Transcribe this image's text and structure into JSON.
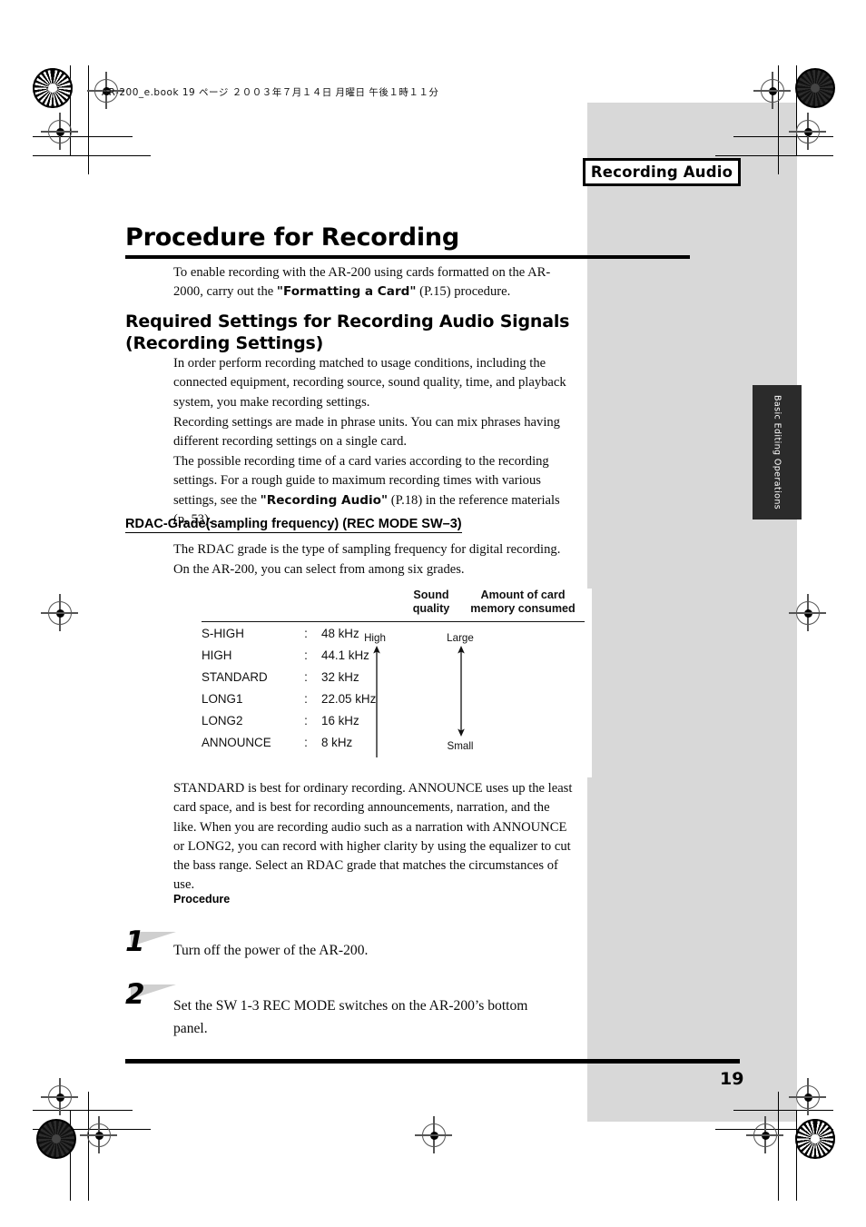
{
  "document": {
    "filestamp": "AR-200_e.book  19 ページ  ２００３年７月１４日   月曜日   午後１時１１分",
    "chapter_tab": "Recording Audio",
    "side_tab": "Basic Editing Operations",
    "page_number": "19"
  },
  "headings": {
    "h1": "Procedure for Recording",
    "h2_line1": "Required Settings for Recording Audio Signals",
    "h2_line2": "(Recording Settings)",
    "h3": "RDAC-Grade(sampling frequency) (REC MODE SW–3)"
  },
  "paragraphs": {
    "intro_a": "To enable recording with the AR-200 using cards formatted on the AR-2000,",
    "intro_b_pre": "carry out the ",
    "intro_b_bold": "\"Formatting a Card\"",
    "intro_b_post": " (P.15) procedure.",
    "p1": "In order perform recording matched to usage conditions, including the connected equipment, recording source, sound quality, time, and playback system, you make recording settings.",
    "p2": "Recording settings are made in phrase units. You can mix phrases having different recording settings on a single card.",
    "p3_pre": "The possible recording time of a card varies according to the recording settings. For a rough guide to maximum recording times with various settings, see the ",
    "p3_bold": "\"Recording Audio\"",
    "p3_post": " (P.18) in the reference materials (p. 53).",
    "p4": "The RDAC grade is the type of sampling frequency for digital recording.",
    "p5": "On the AR-200, you can select from among six grades.",
    "p6": "STANDARD is best for ordinary recording. ANNOUNCE uses up the least card space, and is best for recording announcements, narration, and the like. When you are recording audio such as a narration with ANNOUNCE or LONG2, you can record with higher clarity by using the equalizer to cut the bass range. Select an RDAC grade that matches the circumstances of use."
  },
  "table": {
    "headers": {
      "grade": "",
      "colon": "",
      "frequency": "",
      "sound_quality": "Sound\nquality",
      "sound_quality_l1": "Sound",
      "sound_quality_l2": "quality",
      "memory_l1": "Amount of card",
      "memory_l2": "memory consumed"
    },
    "rows": [
      {
        "grade": "S-HIGH",
        "colon": ":",
        "frequency": "48 kHz"
      },
      {
        "grade": "HIGH",
        "colon": ":",
        "frequency": "44.1 kHz"
      },
      {
        "grade": "STANDARD",
        "colon": ":",
        "frequency": "32 kHz"
      },
      {
        "grade": "LONG1",
        "colon": ":",
        "frequency": "22.05 kHz"
      },
      {
        "grade": "LONG2",
        "colon": ":",
        "frequency": "16 kHz"
      },
      {
        "grade": "ANNOUNCE",
        "colon": ":",
        "frequency": "8 kHz"
      }
    ],
    "scale_labels": {
      "quality_top": "High",
      "memory_top": "Large",
      "memory_bottom": "Small"
    }
  },
  "procedure": {
    "label": "Procedure",
    "steps": [
      {
        "number": "1",
        "text": "Turn off the power of the AR-200."
      },
      {
        "number": "2",
        "text": "Set the SW 1-3 REC MODE switches on the AR-200’s bottom panel."
      }
    ]
  },
  "colors": {
    "page_background": "#ffffff",
    "margin_band": "#d8d8d8",
    "side_tab_background": "#2b2b2b",
    "side_tab_text": "#ffffff",
    "rule": "#000000",
    "step_flag": "#cfcfcf"
  }
}
